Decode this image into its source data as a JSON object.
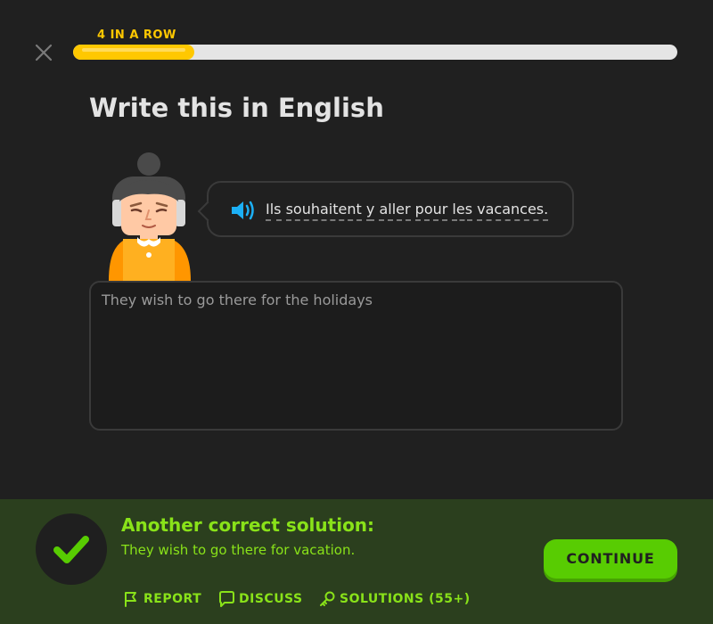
{
  "header": {
    "streak_label": "4 IN A ROW",
    "progress": 0.2
  },
  "lesson": {
    "title": "Write this in English",
    "prompt_words": [
      "Ils",
      "souhaitent",
      "y",
      "aller",
      "pour",
      "les",
      "vacances."
    ],
    "answer_text": "They wish to go there for the holidays"
  },
  "feedback": {
    "title": "Another correct solution:",
    "solution": "They wish to go there for vacation.",
    "continue_label": "CONTINUE",
    "report_label": "REPORT",
    "discuss_label": "DISCUSS",
    "solutions_label": "SOLUTIONS (55+)"
  },
  "icons": {
    "close": "close-icon",
    "speaker": "speaker-icon",
    "check": "checkmark-icon",
    "report": "flag-icon",
    "discuss": "speech-bubble-icon",
    "solutions": "key-icon"
  },
  "colors": {
    "background": "#202020",
    "streak": "#ffc800",
    "progress_fill": "#ffc800",
    "progress_track": "#e5e5e5",
    "footer_bg": "#2b3f1e",
    "feedback_green": "#89e219",
    "continue_button": "#58cc02",
    "speaker_blue": "#1cb0f6"
  }
}
